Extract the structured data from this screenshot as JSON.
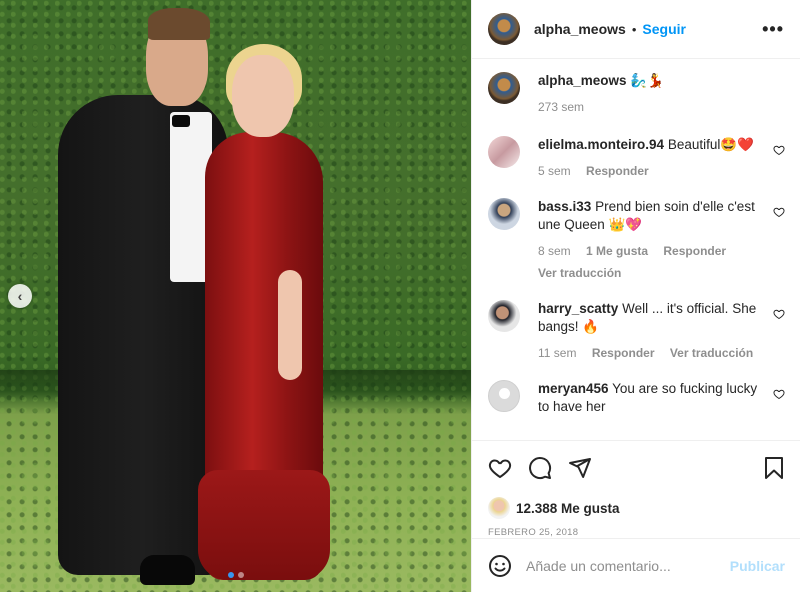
{
  "post": {
    "author": "alpha_meows",
    "follow_label": "Seguir",
    "separator": "•",
    "more_label": "•••",
    "caption_emoji": "🧞‍♂️💃",
    "caption_time": "273 sem",
    "carousel": {
      "index": 1,
      "count": 2
    },
    "prev_label": "‹"
  },
  "comments": [
    {
      "user": "elielma.monteiro.94",
      "text": "Beautiful🤩❤️",
      "time": "5 sem",
      "likes": "",
      "reply": "Responder",
      "translate": ""
    },
    {
      "user": "bass.i33",
      "text": "Prend bien soin d'elle c'est une Queen 👑💖",
      "time": "8 sem",
      "likes": "1 Me gusta",
      "reply": "Responder",
      "translate": "Ver traducción"
    },
    {
      "user": "harry_scatty",
      "text": "Well ... it's official. She bangs! 🔥",
      "time": "11 sem",
      "likes": "",
      "reply": "Responder",
      "translate": "Ver traducción"
    },
    {
      "user": "meryan456",
      "text": "You are so fucking lucky to have her",
      "time": "",
      "likes": "",
      "reply": "",
      "translate": ""
    }
  ],
  "actions": {
    "likes_label": "12.388 Me gusta",
    "date": "FEBRERO 25, 2018"
  },
  "composer": {
    "placeholder": "Añade un comentario...",
    "publish_label": "Publicar"
  },
  "icons": [
    "smile-icon",
    "heart-icon",
    "comment-icon",
    "share-icon",
    "bookmark-icon",
    "more-icon",
    "chevron-left-icon"
  ],
  "colors": {
    "link": "#0095f6",
    "muted": "#8e8e8e",
    "publish_disabled": "#b2dffc",
    "text": "#262626"
  }
}
